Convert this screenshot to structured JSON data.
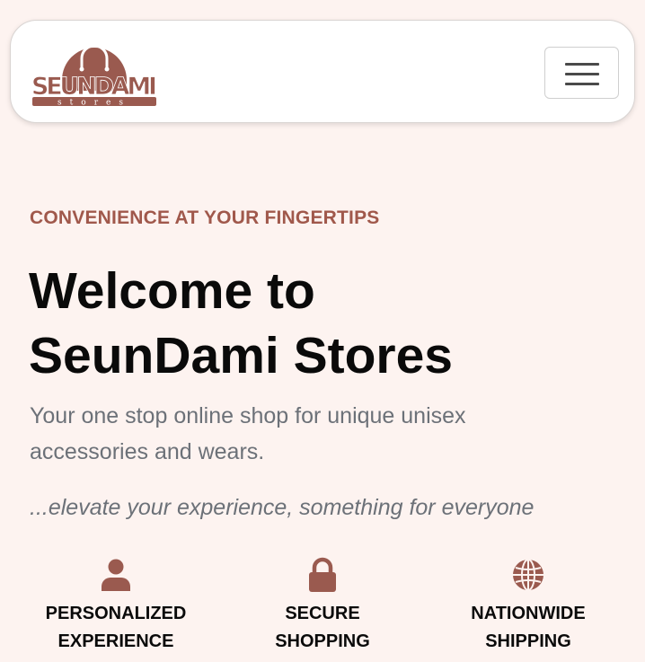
{
  "brand": {
    "name": "SEUNDAMI",
    "sub": "stores",
    "color": "#9a5a4f"
  },
  "hero": {
    "kicker": "CONVENIENCE AT YOUR FINGERTIPS",
    "headline_line1": "Welcome to",
    "headline_line2": "SeunDami Stores",
    "lead_line1": "Your one stop online shop for unique unisex",
    "lead_line2": "accessories and wears.",
    "tagline": "...elevate your experience, something for everyone"
  },
  "features": [
    {
      "icon": "user-icon",
      "line1": "PERSONALIZED",
      "line2": "EXPERIENCE"
    },
    {
      "icon": "lock-icon",
      "line1": "SECURE",
      "line2": "SHOPPING"
    },
    {
      "icon": "globe-icon",
      "line1": "NATIONWIDE",
      "line2": "SHIPPING"
    }
  ],
  "colors": {
    "accent": "#a0584b",
    "background": "#fdf3f0"
  }
}
